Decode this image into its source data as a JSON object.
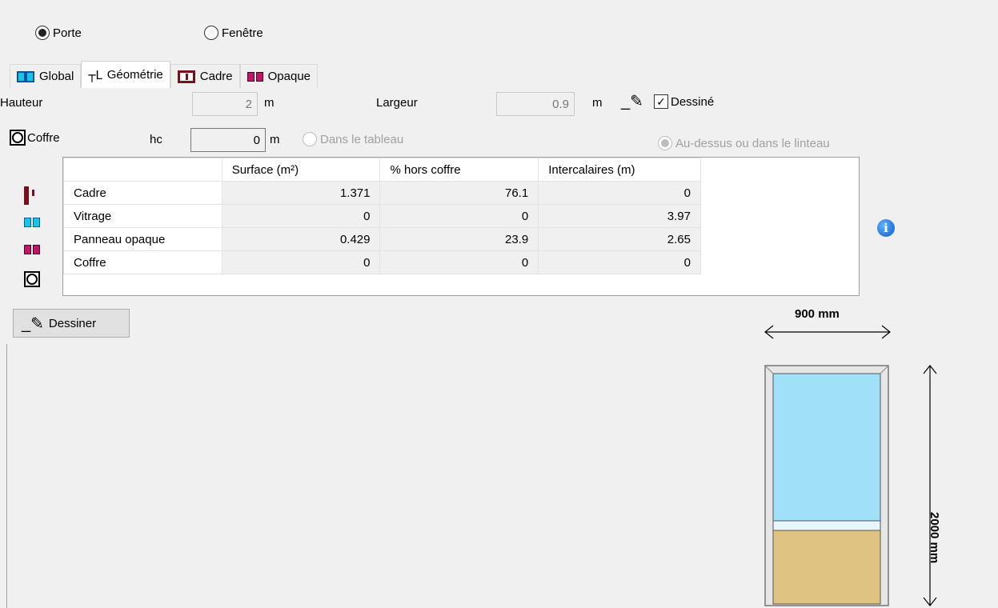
{
  "type_choice": {
    "porte": "Porte",
    "fenetre": "Fenêtre"
  },
  "tabs": [
    {
      "label": "Global"
    },
    {
      "label": "Géométrie"
    },
    {
      "label": "Cadre"
    },
    {
      "label": "Opaque"
    }
  ],
  "geometry": {
    "hauteur_label": "Hauteur",
    "hauteur_value": "2",
    "unit_m": "m",
    "largeur_label": "Largeur",
    "largeur_value": "0.9",
    "dessine_label": "Dessiné",
    "coffre_label": "Coffre",
    "hc_label": "hc",
    "hc_value": "0",
    "dans_tableau": "Dans le tableau",
    "au_dessus": "Au-dessus ou dans le linteau"
  },
  "table": {
    "headers": [
      "Surface (m²)",
      "% hors coffre",
      "Intercalaires (m)"
    ],
    "rows": [
      {
        "label": "Cadre",
        "icon": "cadre-icon",
        "surface": "1.371",
        "pct": "76.1",
        "inter": "0"
      },
      {
        "label": "Vitrage",
        "icon": "vitrage-icon",
        "surface": "0",
        "pct": "0",
        "inter": "3.97"
      },
      {
        "label": "Panneau opaque",
        "icon": "opaque-icon",
        "surface": "0.429",
        "pct": "23.9",
        "inter": "2.65"
      },
      {
        "label": "Coffre",
        "icon": "coffre-icon",
        "surface": "0",
        "pct": "0",
        "inter": "0"
      }
    ]
  },
  "dessiner_button": "Dessiner",
  "drawing": {
    "width_label": "900 mm",
    "height_label": "2000 mm"
  },
  "colors": {
    "glass": "#a0e0f8",
    "opaque": "#dfc383",
    "frame": "#7a0f1c"
  }
}
